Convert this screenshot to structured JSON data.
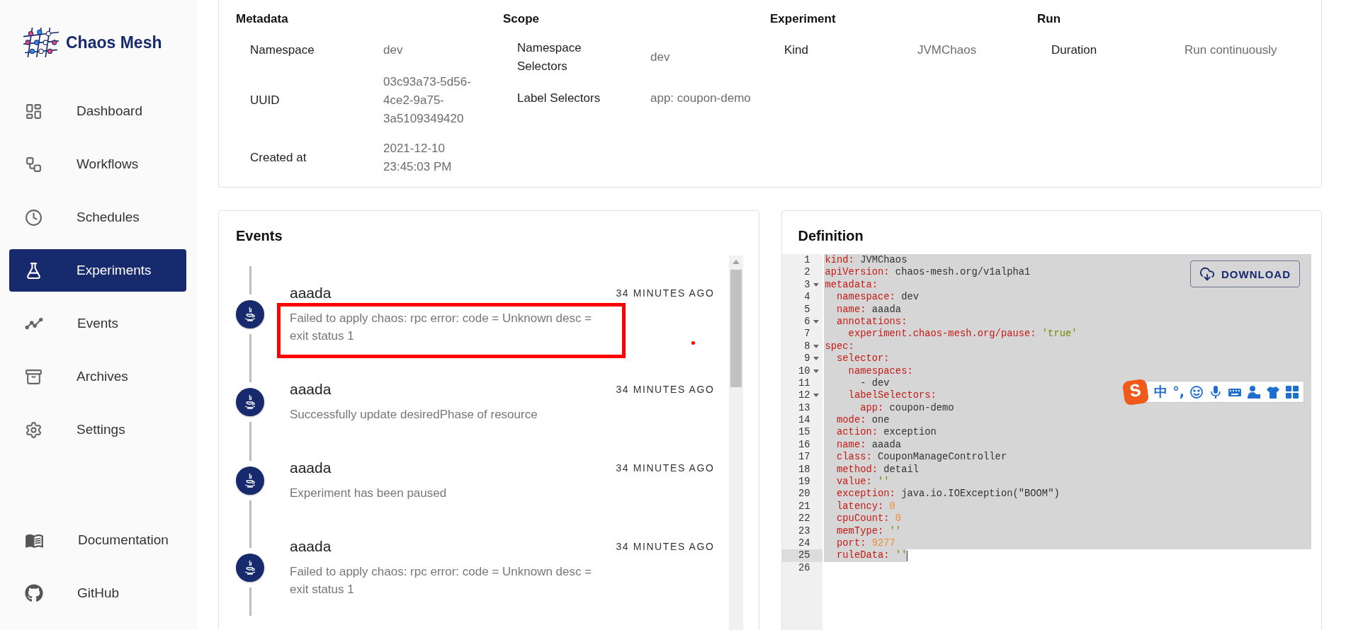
{
  "sidebar": {
    "logo_text": "Chaos Mesh",
    "items": [
      {
        "label": "Dashboard",
        "selected": false
      },
      {
        "label": "Workflows",
        "selected": false
      },
      {
        "label": "Schedules",
        "selected": false
      },
      {
        "label": "Experiments",
        "selected": true
      },
      {
        "label": "Events",
        "selected": false
      },
      {
        "label": "Archives",
        "selected": false
      },
      {
        "label": "Settings",
        "selected": false
      }
    ],
    "footer_items": [
      {
        "label": "Documentation"
      },
      {
        "label": "GitHub"
      }
    ]
  },
  "summary": [
    {
      "heading": "Metadata",
      "rows": [
        {
          "label": "Namespace",
          "value": "dev"
        },
        {
          "label": "UUID",
          "value": "03c93a73-5d56-4ce2-9a75-3a5109349420"
        },
        {
          "label": "Created at",
          "value": "2021-12-10 23:45:03 PM"
        }
      ]
    },
    {
      "heading": "Scope",
      "rows": [
        {
          "label": "Namespace Selectors",
          "value": "dev"
        },
        {
          "label": "Label Selectors",
          "value": "app: coupon-demo"
        }
      ]
    },
    {
      "heading": "Experiment",
      "rows": [
        {
          "label": "Kind",
          "value": "JVMChaos"
        }
      ]
    },
    {
      "heading": "Run",
      "rows": [
        {
          "label": "Duration",
          "value": "Run continuously"
        }
      ]
    }
  ],
  "events": {
    "title": "Events",
    "items": [
      {
        "title": "aaada",
        "message": "Failed to apply chaos: rpc error: code = Unknown desc = exit status 1",
        "time": "34 MINUTES AGO",
        "highlighted": true,
        "marked": true
      },
      {
        "title": "aaada",
        "message": "Successfully update desiredPhase of resource",
        "time": "34 MINUTES AGO",
        "highlighted": false,
        "marked": false
      },
      {
        "title": "aaada",
        "message": "Experiment has been paused",
        "time": "34 MINUTES AGO",
        "highlighted": false,
        "marked": false
      },
      {
        "title": "aaada",
        "message": "Failed to apply chaos: rpc error: code = Unknown desc = exit status 1",
        "time": "34 MINUTES AGO",
        "highlighted": false,
        "marked": false
      }
    ]
  },
  "definition": {
    "title": "Definition",
    "download_label": "DOWNLOAD",
    "ime": {
      "logo": "S",
      "mode": "中",
      "punct": "°,"
    },
    "lines": [
      {
        "number": "1",
        "foldable": false,
        "active": false,
        "selected": true,
        "tokens": [
          {
            "kind": "key",
            "text": "kind:"
          },
          {
            "kind": "plain",
            "text": " JVMChaos"
          }
        ]
      },
      {
        "number": "2",
        "foldable": false,
        "active": false,
        "selected": true,
        "tokens": [
          {
            "kind": "key",
            "text": "apiVersion:"
          },
          {
            "kind": "plain",
            "text": " chaos-mesh.org/v1alpha1"
          }
        ]
      },
      {
        "number": "3",
        "foldable": true,
        "active": false,
        "selected": true,
        "tokens": [
          {
            "kind": "key",
            "text": "metadata:"
          }
        ]
      },
      {
        "number": "4",
        "foldable": false,
        "active": false,
        "selected": true,
        "tokens": [
          {
            "kind": "key",
            "text": "  namespace:"
          },
          {
            "kind": "plain",
            "text": " dev"
          }
        ]
      },
      {
        "number": "5",
        "foldable": false,
        "active": false,
        "selected": true,
        "tokens": [
          {
            "kind": "key",
            "text": "  name:"
          },
          {
            "kind": "plain",
            "text": " aaada"
          }
        ]
      },
      {
        "number": "6",
        "foldable": true,
        "active": false,
        "selected": true,
        "tokens": [
          {
            "kind": "key",
            "text": "  annotations:"
          }
        ]
      },
      {
        "number": "7",
        "foldable": false,
        "active": false,
        "selected": true,
        "tokens": [
          {
            "kind": "key",
            "text": "    experiment.chaos-mesh.org/pause:"
          },
          {
            "kind": "string",
            "text": " 'true'"
          }
        ]
      },
      {
        "number": "8",
        "foldable": true,
        "active": false,
        "selected": true,
        "tokens": [
          {
            "kind": "key",
            "text": "spec:"
          }
        ]
      },
      {
        "number": "9",
        "foldable": true,
        "active": false,
        "selected": true,
        "tokens": [
          {
            "kind": "key",
            "text": "  selector:"
          }
        ]
      },
      {
        "number": "10",
        "foldable": true,
        "active": false,
        "selected": true,
        "tokens": [
          {
            "kind": "key",
            "text": "    namespaces:"
          }
        ]
      },
      {
        "number": "11",
        "foldable": false,
        "active": false,
        "selected": true,
        "tokens": [
          {
            "kind": "plain",
            "text": "      - dev"
          }
        ]
      },
      {
        "number": "12",
        "foldable": true,
        "active": false,
        "selected": true,
        "tokens": [
          {
            "kind": "key",
            "text": "    labelSelectors:"
          }
        ]
      },
      {
        "number": "13",
        "foldable": false,
        "active": false,
        "selected": true,
        "tokens": [
          {
            "kind": "key",
            "text": "      app:"
          },
          {
            "kind": "plain",
            "text": " coupon-demo"
          }
        ]
      },
      {
        "number": "14",
        "foldable": false,
        "active": false,
        "selected": true,
        "tokens": [
          {
            "kind": "key",
            "text": "  mode:"
          },
          {
            "kind": "plain",
            "text": " one"
          }
        ]
      },
      {
        "number": "15",
        "foldable": false,
        "active": false,
        "selected": true,
        "tokens": [
          {
            "kind": "key",
            "text": "  action:"
          },
          {
            "kind": "plain",
            "text": " exception"
          }
        ]
      },
      {
        "number": "16",
        "foldable": false,
        "active": false,
        "selected": true,
        "tokens": [
          {
            "kind": "key",
            "text": "  name:"
          },
          {
            "kind": "plain",
            "text": " aaada"
          }
        ]
      },
      {
        "number": "17",
        "foldable": false,
        "active": false,
        "selected": true,
        "tokens": [
          {
            "kind": "key",
            "text": "  class:"
          },
          {
            "kind": "plain",
            "text": " CouponManageController"
          }
        ]
      },
      {
        "number": "18",
        "foldable": false,
        "active": false,
        "selected": true,
        "tokens": [
          {
            "kind": "key",
            "text": "  method:"
          },
          {
            "kind": "plain",
            "text": " detail"
          }
        ]
      },
      {
        "number": "19",
        "foldable": false,
        "active": false,
        "selected": true,
        "tokens": [
          {
            "kind": "key",
            "text": "  value:"
          },
          {
            "kind": "string",
            "text": " ''"
          }
        ]
      },
      {
        "number": "20",
        "foldable": false,
        "active": false,
        "selected": true,
        "tokens": [
          {
            "kind": "key",
            "text": "  exception:"
          },
          {
            "kind": "plain",
            "text": " java.io.IOException(\"BOOM\")"
          }
        ]
      },
      {
        "number": "21",
        "foldable": false,
        "active": false,
        "selected": true,
        "tokens": [
          {
            "kind": "key",
            "text": "  latency:"
          },
          {
            "kind": "number",
            "text": " 0"
          }
        ]
      },
      {
        "number": "22",
        "foldable": false,
        "active": false,
        "selected": true,
        "tokens": [
          {
            "kind": "key",
            "text": "  cpuCount:"
          },
          {
            "kind": "number",
            "text": " 0"
          }
        ]
      },
      {
        "number": "23",
        "foldable": false,
        "active": false,
        "selected": true,
        "tokens": [
          {
            "kind": "key",
            "text": "  memType:"
          },
          {
            "kind": "string",
            "text": " ''"
          }
        ]
      },
      {
        "number": "24",
        "foldable": false,
        "active": false,
        "selected": true,
        "tokens": [
          {
            "kind": "key",
            "text": "  port:"
          },
          {
            "kind": "number",
            "text": " 9277"
          }
        ]
      },
      {
        "number": "25",
        "foldable": false,
        "active": true,
        "selected": true,
        "tokens": [
          {
            "kind": "key",
            "text": "  ruleData:"
          },
          {
            "kind": "string",
            "text": " ''"
          }
        ]
      },
      {
        "number": "26",
        "foldable": false,
        "active": false,
        "selected": false
      }
    ]
  }
}
